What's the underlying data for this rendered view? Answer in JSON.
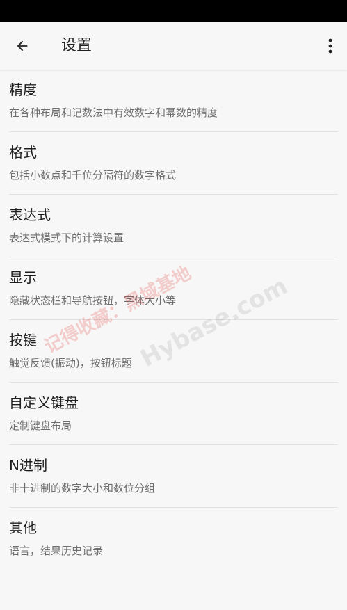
{
  "app_bar": {
    "title": "设置",
    "back_icon": "arrow-back-icon",
    "more_icon": "more-vert-icon"
  },
  "settings": [
    {
      "title": "精度",
      "summary": "在各种布局和记数法中有效数字和幂数的精度"
    },
    {
      "title": "格式",
      "summary": "包括小数点和千位分隔符的数字格式"
    },
    {
      "title": "表达式",
      "summary": "表达式模式下的计算设置"
    },
    {
      "title": "显示",
      "summary": "隐藏状态栏和导航按钮，字体大小等"
    },
    {
      "title": "按键",
      "summary": "触觉反馈(振动)，按钮标题"
    },
    {
      "title": "自定义键盘",
      "summary": "定制键盘布局"
    },
    {
      "title": "N进制",
      "summary": "非十进制的数字大小和数位分组"
    },
    {
      "title": "其他",
      "summary": "语言，结果历史记录"
    }
  ],
  "watermark": {
    "line1": "记得收藏：黑域基地",
    "line2": "Hybase.com"
  },
  "colors": {
    "status_bar": "#000000",
    "background": "#f7f7f7",
    "title_text": "#1f1f1f",
    "summary_text": "#6e6e6e",
    "divider": "#e2e2e2",
    "watermark_red": "#e53935",
    "watermark_gray": "#9e9e9e"
  }
}
